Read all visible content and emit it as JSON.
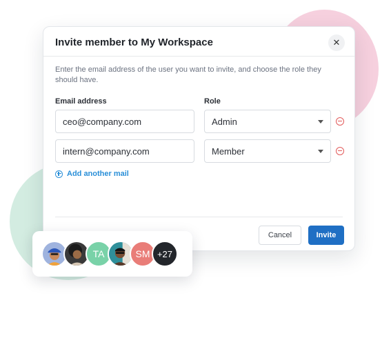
{
  "modal": {
    "title": "Invite member to My Workspace",
    "close_label": "✕",
    "description": "Enter the email address of the user you want to invite, and choose the role they should have.",
    "email_label": "Email address",
    "role_label": "Role",
    "rows": [
      {
        "email": "ceo@company.com",
        "role": "Admin"
      },
      {
        "email": "intern@company.com",
        "role": "Member"
      }
    ],
    "add_link": "Add another mail",
    "cancel_label": "Cancel",
    "invite_label": "Invite"
  },
  "avatars": {
    "items": [
      {
        "type": "photo",
        "icon": "person-blue-hat-photo",
        "bg": "#8fa6d8"
      },
      {
        "type": "photo",
        "icon": "person-curly-hair-photo",
        "bg": "#3b3b3b"
      },
      {
        "type": "initials",
        "text": "TA",
        "bg": "#79d2a8"
      },
      {
        "type": "photo",
        "icon": "person-sunglasses-photo",
        "bg": "#2f8f9a"
      },
      {
        "type": "initials",
        "text": "SM",
        "bg": "#e97d78"
      },
      {
        "type": "initials",
        "text": "+27",
        "bg": "#23262b"
      }
    ]
  },
  "colors": {
    "primary": "#1f6fc4",
    "link": "#2a8fd8",
    "danger": "#e25a5a",
    "blob_pink": "#f6d0de",
    "blob_green": "#d3ece1"
  }
}
